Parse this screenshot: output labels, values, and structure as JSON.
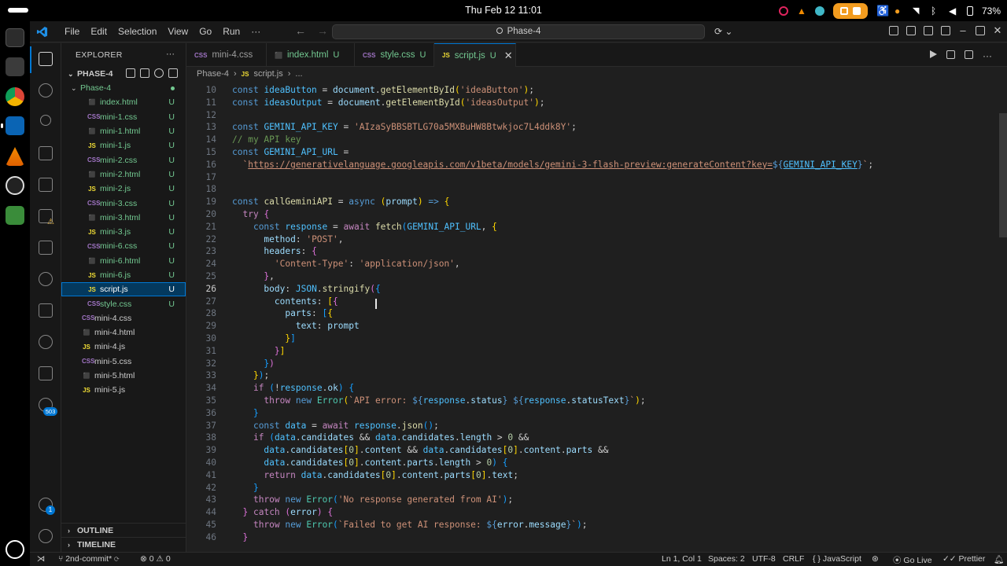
{
  "os": {
    "clock": "Thu Feb 12  11:01",
    "battery": "73%"
  },
  "titlebar": {
    "menu": [
      "File",
      "Edit",
      "Selection",
      "View",
      "Go",
      "Run",
      "···"
    ],
    "search": "Phase-4"
  },
  "sidebar": {
    "explorer_label": "EXPLORER",
    "explorer_more": "···",
    "workspace": "PHASE-4",
    "folder": "Phase-4",
    "folder_files": [
      {
        "icon": "html",
        "name": "index.html",
        "status": "U"
      },
      {
        "icon": "css",
        "name": "mini-1.css",
        "status": "U"
      },
      {
        "icon": "html",
        "name": "mini-1.html",
        "status": "U"
      },
      {
        "icon": "js",
        "name": "mini-1.js",
        "status": "U"
      },
      {
        "icon": "css",
        "name": "mini-2.css",
        "status": "U"
      },
      {
        "icon": "html",
        "name": "mini-2.html",
        "status": "U"
      },
      {
        "icon": "js",
        "name": "mini-2.js",
        "status": "U"
      },
      {
        "icon": "css",
        "name": "mini-3.css",
        "status": "U"
      },
      {
        "icon": "html",
        "name": "mini-3.html",
        "status": "U"
      },
      {
        "icon": "js",
        "name": "mini-3.js",
        "status": "U"
      },
      {
        "icon": "css",
        "name": "mini-6.css",
        "status": "U"
      },
      {
        "icon": "html",
        "name": "mini-6.html",
        "status": "U"
      },
      {
        "icon": "js",
        "name": "mini-6.js",
        "status": "U"
      },
      {
        "icon": "js",
        "name": "script.js",
        "status": "U",
        "selected": true
      },
      {
        "icon": "css",
        "name": "style.css",
        "status": "U"
      }
    ],
    "root_files": [
      {
        "icon": "css",
        "name": "mini-4.css"
      },
      {
        "icon": "html",
        "name": "mini-4.html"
      },
      {
        "icon": "js",
        "name": "mini-4.js"
      },
      {
        "icon": "css",
        "name": "mini-5.css"
      },
      {
        "icon": "html",
        "name": "mini-5.html"
      },
      {
        "icon": "js",
        "name": "mini-5.js"
      }
    ],
    "outline": "OUTLINE",
    "timeline": "TIMELINE"
  },
  "activity": {
    "badge_scm": "503",
    "badge_accounts": "1"
  },
  "tabs": [
    {
      "icon": "css",
      "label": "mini-4.css",
      "status": "",
      "active": false
    },
    {
      "icon": "html",
      "label": "index.html",
      "status": "U",
      "active": false
    },
    {
      "icon": "css",
      "label": "style.css",
      "status": "U",
      "active": false
    },
    {
      "icon": "js",
      "label": "script.js",
      "status": "U",
      "active": true
    }
  ],
  "breadcrumb": {
    "folder": "Phase-4",
    "file": "script.js",
    "tail": "..."
  },
  "editor": {
    "first_line": 10,
    "current_line": 26,
    "last_line": 46
  },
  "statusbar": {
    "branch": "2nd-commit*",
    "errors": "0",
    "warnings": "0",
    "position": "Ln 1, Col 1",
    "spaces": "Spaces: 2",
    "encoding": "UTF-8",
    "eol": "CRLF",
    "language": "JavaScript",
    "golive": "Go Live",
    "prettier": "Prettier"
  },
  "colors": {
    "accent": "#0078d4",
    "untracked": "#73c991",
    "html_icon": "#e44d26",
    "css_icon": "#a074c4",
    "js_icon": "#f1dd35"
  }
}
